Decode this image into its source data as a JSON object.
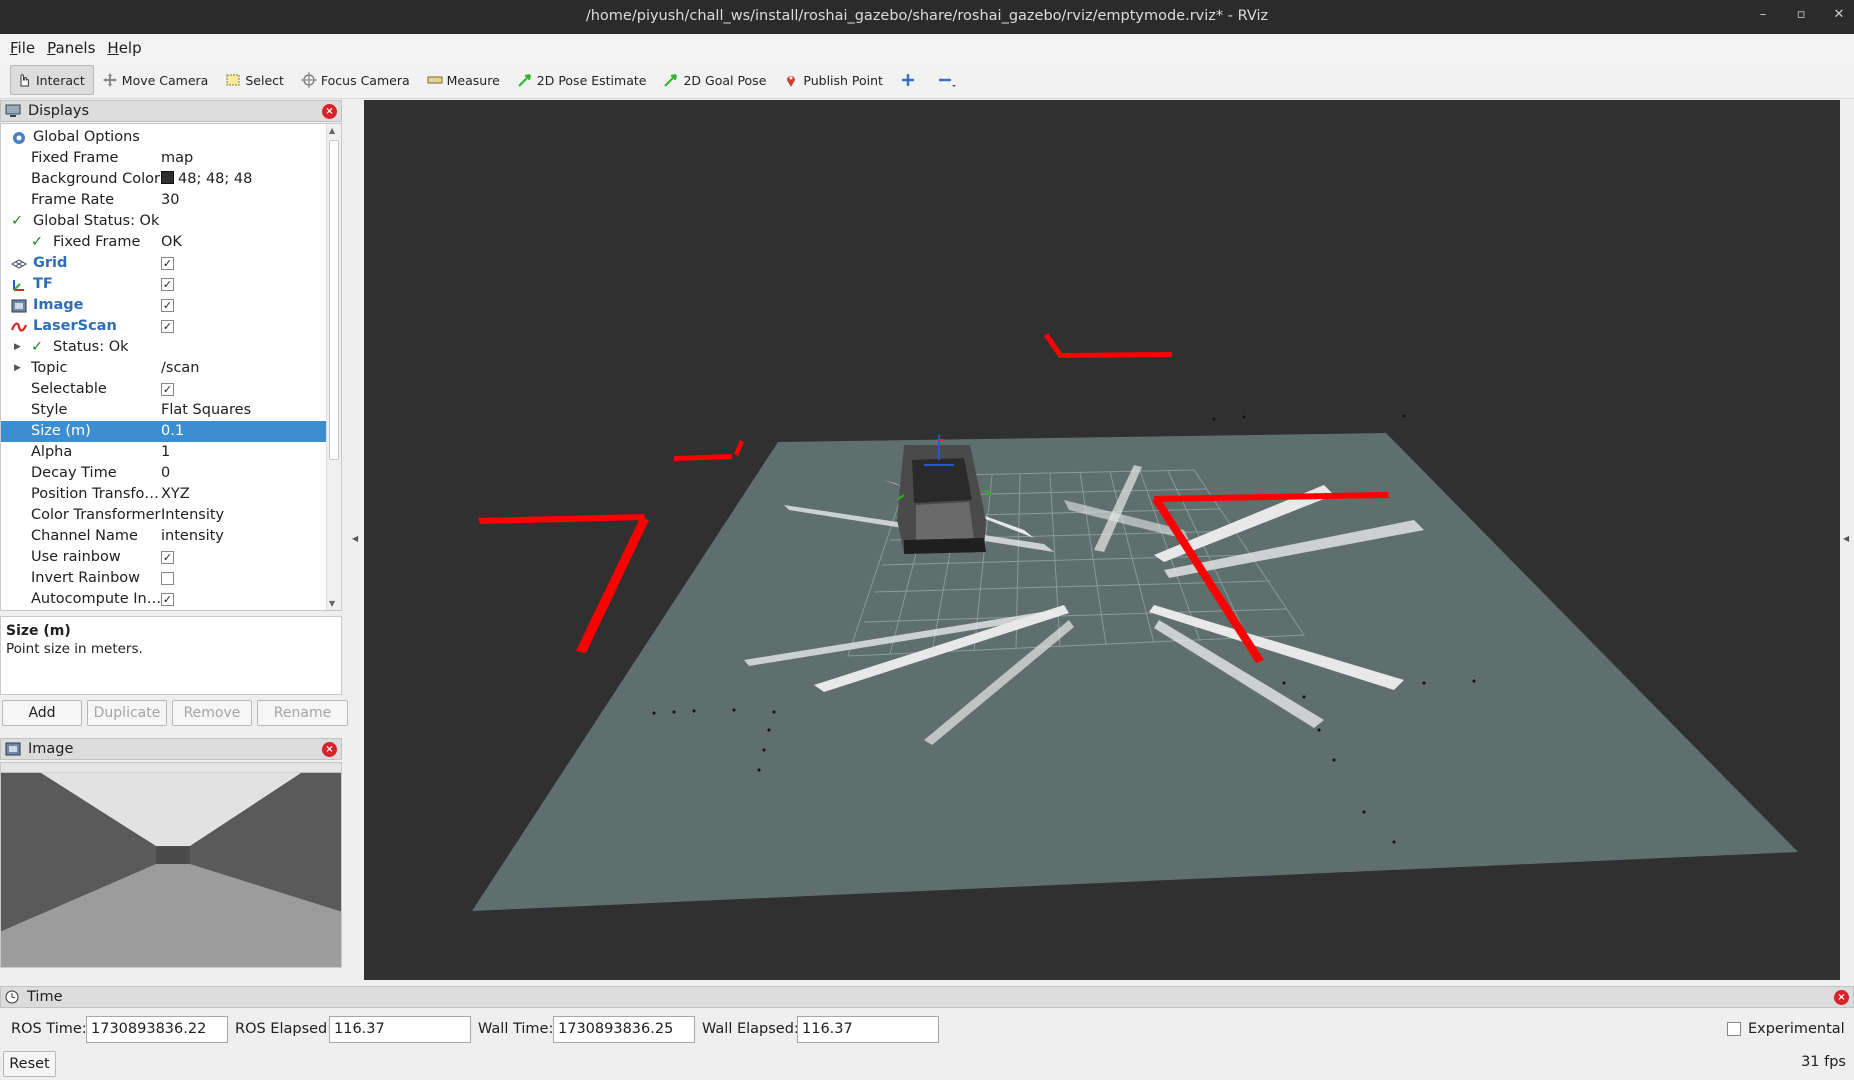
{
  "window": {
    "title": "/home/piyush/chall_ws/install/roshai_gazebo/share/roshai_gazebo/rviz/emptymode.rviz* - RViz"
  },
  "menu": [
    "File",
    "Panels",
    "Help"
  ],
  "toolbar": {
    "interact": "Interact",
    "move_camera": "Move Camera",
    "select": "Select",
    "focus_camera": "Focus Camera",
    "measure": "Measure",
    "pose_estimate": "2D Pose Estimate",
    "goal_pose": "2D Goal Pose",
    "publish_point": "Publish Point"
  },
  "displays": {
    "title": "Displays",
    "rows": [
      {
        "name": "Global Options",
        "value": ""
      },
      {
        "name": "Fixed Frame",
        "value": "map"
      },
      {
        "name": "Background Color",
        "value": "48; 48; 48"
      },
      {
        "name": "Frame Rate",
        "value": "30"
      },
      {
        "name": "Global Status: Ok",
        "value": ""
      },
      {
        "name": "Fixed Frame",
        "value": "OK"
      },
      {
        "name": "Grid",
        "value": ""
      },
      {
        "name": "TF",
        "value": ""
      },
      {
        "name": "Image",
        "value": ""
      },
      {
        "name": "LaserScan",
        "value": ""
      },
      {
        "name": "Status: Ok",
        "value": ""
      },
      {
        "name": "Topic",
        "value": "/scan"
      },
      {
        "name": "Selectable",
        "value": ""
      },
      {
        "name": "Style",
        "value": "Flat Squares"
      },
      {
        "name": "Size (m)",
        "value": "0.1"
      },
      {
        "name": "Alpha",
        "value": "1"
      },
      {
        "name": "Decay Time",
        "value": "0"
      },
      {
        "name": "Position Transfo…",
        "value": "XYZ"
      },
      {
        "name": "Color Transformer",
        "value": "Intensity"
      },
      {
        "name": "Channel Name",
        "value": "intensity"
      },
      {
        "name": "Use rainbow",
        "value": ""
      },
      {
        "name": "Invert Rainbow",
        "value": ""
      },
      {
        "name": "Autocompute In…",
        "value": ""
      }
    ],
    "description_title": "Size (m)",
    "description_text": "Point size in meters.",
    "buttons": {
      "add": "Add",
      "duplicate": "Duplicate",
      "remove": "Remove",
      "rename": "Rename"
    }
  },
  "image_panel": {
    "title": "Image"
  },
  "time": {
    "title": "Time",
    "ros_time_label": "ROS Time:",
    "ros_time": "1730893836.22",
    "ros_elapsed_label": "ROS Elapsed:",
    "ros_elapsed": "116.37",
    "wall_time_label": "Wall Time:",
    "wall_time": "1730893836.25",
    "wall_elapsed_label": "Wall Elapsed:",
    "wall_elapsed": "116.37",
    "experimental": "Experimental",
    "reset": "Reset",
    "fps": "31 fps"
  },
  "colors": {
    "background": "#303030",
    "ground_plane": "#5f6f6d",
    "laser_points": "#ff0000",
    "selection": "#3d8dd1"
  }
}
